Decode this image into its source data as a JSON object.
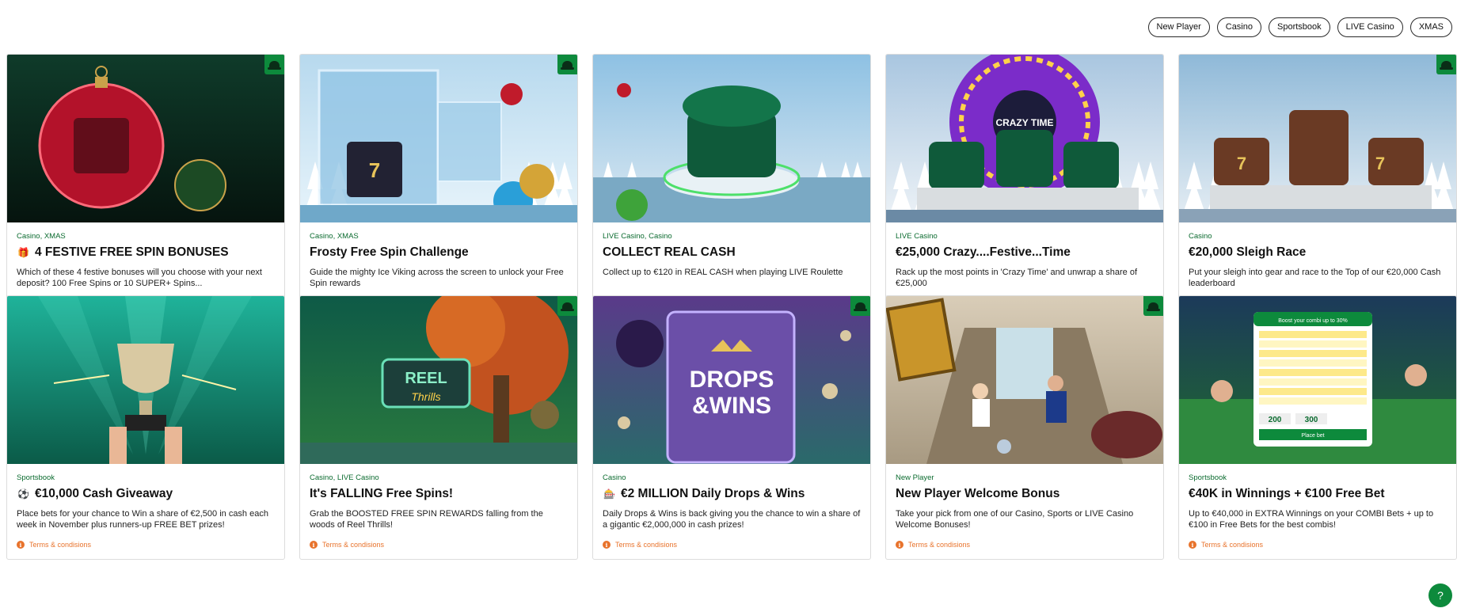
{
  "filters": [
    "New Player",
    "Casino",
    "Sportsbook",
    "LIVE Casino",
    "XMAS"
  ],
  "terms_label": "Terms & condisions",
  "colors": {
    "accent_green": "#0d8a3c",
    "tag_green": "#0b6b2f",
    "terms_orange": "#e8732c"
  },
  "cards": [
    {
      "tags": "Casino, XMAS",
      "icon": "gift-icon",
      "icon_glyph": "🎁",
      "title": "4 FESTIVE FREE SPIN BONUSES",
      "desc": "Which of these 4 festive bonuses will you choose with your next deposit? 100 Free Spins or 10 SUPER+ Spins...",
      "badge": true,
      "theme": "ornament"
    },
    {
      "tags": "Casino, XMAS",
      "icon": "",
      "title": "Frosty Free Spin Challenge",
      "desc": "Guide the mighty Ice Viking across the screen to unlock your Free Spin rewards",
      "badge": true,
      "theme": "ice"
    },
    {
      "tags": "LIVE Casino, Casino",
      "icon": "",
      "title": "COLLECT REAL CASH",
      "desc": "Collect up to €120 in REAL CASH when playing LIVE Roulette",
      "badge": false,
      "theme": "snowlake"
    },
    {
      "tags": "LIVE Casino",
      "icon": "",
      "title": "€25,000 Crazy....Festive...Time",
      "desc": "Rack up the most points in 'Crazy Time' and unwrap a share of €25,000",
      "badge": false,
      "theme": "wheel"
    },
    {
      "tags": "Casino",
      "icon": "",
      "title": "€20,000 Sleigh Race",
      "desc": "Put your sleigh into gear and race to the Top of our €20,000 Cash leaderboard",
      "badge": true,
      "theme": "snowgifts"
    },
    {
      "tags": "Sportsbook",
      "icon": "soccer-ball-icon",
      "icon_glyph": "⚽",
      "title": "€10,000 Cash Giveaway",
      "desc": "Place bets for your chance to Win a share of €2,500 in cash each week in November plus runners-up FREE BET prizes!",
      "badge": false,
      "theme": "trophy"
    },
    {
      "tags": "Casino, LIVE Casino",
      "icon": "",
      "title": "It's FALLING Free Spins!",
      "desc": "Grab the BOOSTED FREE SPIN REWARDS falling from the woods of Reel Thrills!",
      "badge": true,
      "theme": "forest"
    },
    {
      "tags": "Casino",
      "icon": "slot-machine-icon",
      "icon_glyph": "🎰",
      "title": "€2 MILLION Daily Drops & Wins",
      "desc": "Daily Drops & Wins is back giving you the chance to win a share of a gigantic €2,000,000 in cash prizes!",
      "badge": true,
      "theme": "drops"
    },
    {
      "tags": "New Player",
      "icon": "",
      "title": "New Player Welcome Bonus",
      "desc": "Take your pick from one of our Casino, Sports or LIVE Casino Welcome Bonuses!",
      "badge": true,
      "theme": "hallway"
    },
    {
      "tags": "Sportsbook",
      "icon": "",
      "title": "€40K in Winnings + €100 Free Bet",
      "desc": "Up to €40,000 in EXTRA Winnings on your COMBI Bets + up to €100 in Free Bets for the best combis!",
      "badge": false,
      "theme": "stadium"
    }
  ],
  "image_texts": {
    "drops": [
      "DROPS",
      "&WINS"
    ],
    "reel": [
      "REEL",
      "Thrills"
    ],
    "combi_header": "Boost your combi up to 30%",
    "combi_values": [
      "200",
      "300"
    ],
    "combi_button": "Place bet",
    "wheel_center": "CRAZY TIME"
  }
}
